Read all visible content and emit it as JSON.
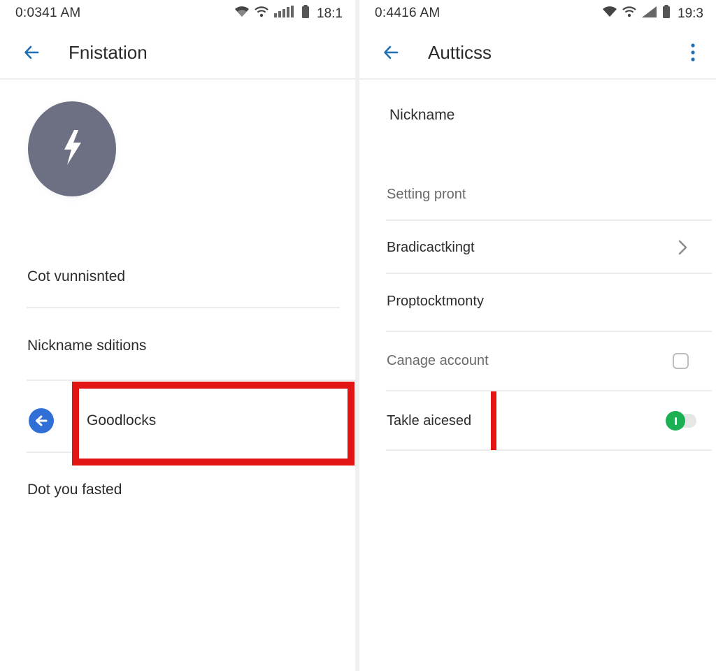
{
  "left_screen": {
    "status_bar": {
      "time": "0:0341 AM",
      "clock": "18:1"
    },
    "app_bar": {
      "title": "Fnistation",
      "back_icon": "arrow-back-icon"
    },
    "avatar": {
      "icon": "lightning-bolt-icon",
      "color": "#6d6f82"
    },
    "items": [
      {
        "label": "Cot vunnisnted"
      },
      {
        "label": "Nickname sditions"
      },
      {
        "label": "Goodlocks",
        "icon": "arrow-left-circle-icon",
        "highlighted": true
      },
      {
        "label": "Dot you fasted"
      }
    ]
  },
  "right_screen": {
    "status_bar": {
      "time": "0:4416 AM",
      "clock": "19:3"
    },
    "app_bar": {
      "title": "Autticss",
      "back_icon": "arrow-back-icon",
      "more_icon": "more-vert-icon"
    },
    "nickname_label": "Nickname",
    "items": [
      {
        "label": "Setting pront",
        "muted": true
      },
      {
        "label": "Bradicactkingt",
        "control": "chevron-right-icon"
      },
      {
        "label": "Proptocktmonty"
      },
      {
        "label": "Canage account",
        "muted": true,
        "control": "checkbox",
        "checked": false
      },
      {
        "label": "Takle aicesed",
        "control": "toggle",
        "on": true,
        "highlighted": true
      }
    ]
  },
  "colors": {
    "accent": "#2f6fd6",
    "highlight": "#e21414",
    "toggle_on": "#1bb053",
    "avatar": "#6d6f82"
  }
}
